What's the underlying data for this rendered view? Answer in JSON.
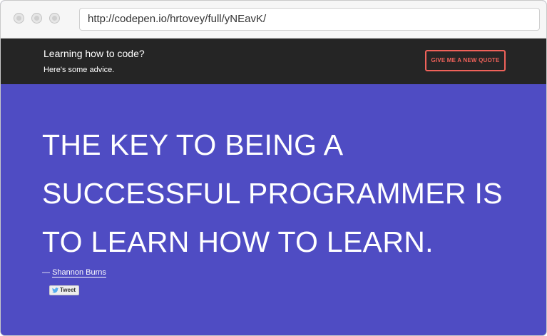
{
  "browser": {
    "url": "http://codepen.io/hrtovey/full/yNEavK/"
  },
  "header": {
    "title": "Learning how to code?",
    "subtitle": "Here's some advice.",
    "quote_button_label": "GIVE ME A NEW QUOTE"
  },
  "quote": {
    "text": "THE KEY TO BEING A SUCCESSFUL PROGRAMMER IS TO LEARN HOW TO LEARN.",
    "dash": "—",
    "author": "Shannon Burns"
  },
  "tweet": {
    "label": "Tweet",
    "icon": "twitter-bird-icon"
  },
  "colors": {
    "header_bg": "#252525",
    "main_bg": "#4f4cc3",
    "accent": "#f0625a"
  }
}
